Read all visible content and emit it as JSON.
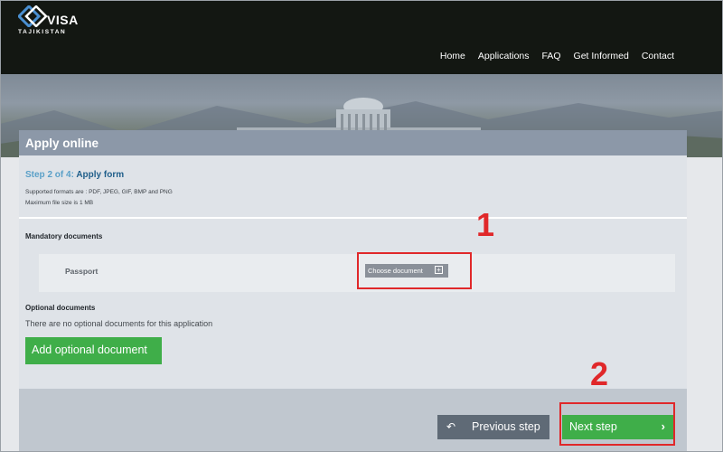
{
  "logo": {
    "text": "VISA",
    "subtitle": "TAJIKISTAN"
  },
  "nav": {
    "items": [
      "Home",
      "Applications",
      "FAQ",
      "Get Informed",
      "Contact"
    ]
  },
  "panel": {
    "title": "Apply online",
    "step_number": "Step 2 of 4:",
    "step_name": "Apply form",
    "formats_note": "Supported formats are : PDF, JPEG, GIF, BMP and PNG",
    "max_size_note": "Maximum file size is 1 MB",
    "mandatory_heading": "Mandatory documents",
    "mandatory_docs": [
      {
        "label": "Passport",
        "button_label": "Choose document",
        "button_icon": "plus-box-icon"
      }
    ],
    "optional_heading": "Optional documents",
    "optional_empty_text": "There are no optional documents for this application",
    "add_optional_label": "Add optional document"
  },
  "footer": {
    "prev_label": "Previous step",
    "prev_icon": "undo-arrow-icon",
    "next_label": "Next step",
    "next_icon": "chevron-right-icon"
  },
  "annotations": {
    "one": "1",
    "two": "2"
  },
  "colors": {
    "header_bg": "#131712",
    "panel_header": "#8c98a8",
    "green": "#3fae49",
    "annotation_red": "#e0282a",
    "step_blue": "#1f5e8a"
  }
}
